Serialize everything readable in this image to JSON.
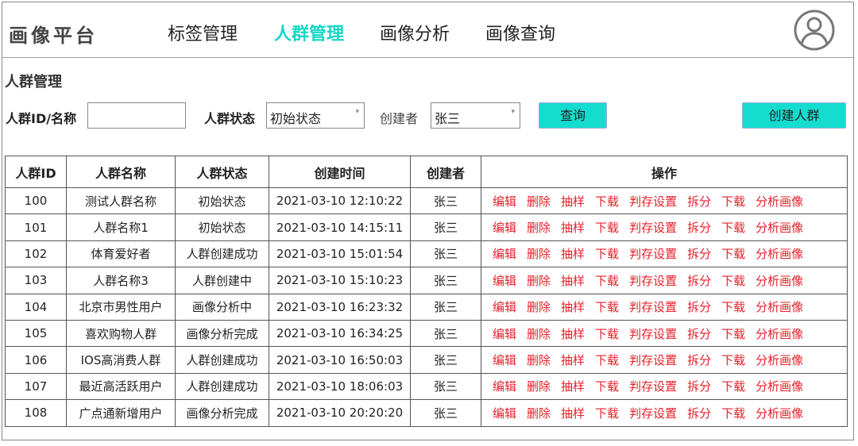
{
  "header": {
    "logo": "画像平台",
    "nav": [
      "标签管理",
      "人群管理",
      "画像分析",
      "画像查询"
    ],
    "active_index": 1
  },
  "page_title": "人群管理",
  "filters": {
    "id_name_label": "人群ID/名称",
    "id_name_value": "",
    "status_label": "人群状态",
    "status_value": "初始状态",
    "creator_label": "创建者",
    "creator_value": "张三",
    "query_button": "查询",
    "create_button": "创建人群"
  },
  "colors": {
    "accent": "#14ddd0",
    "action": "#e8202a"
  },
  "table": {
    "headers": [
      "人群ID",
      "人群名称",
      "人群状态",
      "创建时间",
      "创建者",
      "操作"
    ],
    "actions": [
      "编辑",
      "删除",
      "抽样",
      "下载",
      "判存设置",
      "拆分",
      "下载",
      "分析画像"
    ],
    "rows": [
      [
        "100",
        "测试人群名称",
        "初始状态",
        "2021-03-10 12:10:22",
        "张三"
      ],
      [
        "101",
        "人群名称1",
        "初始状态",
        "2021-03-10 14:15:11",
        "张三"
      ],
      [
        "102",
        "体育爱好者",
        "人群创建成功",
        "2021-03-10 15:01:54",
        "张三"
      ],
      [
        "103",
        "人群名称3",
        "人群创建中",
        "2021-03-10 15:10:23",
        "张三"
      ],
      [
        "104",
        "北京市男性用户",
        "画像分析中",
        "2021-03-10 16:23:32",
        "张三"
      ],
      [
        "105",
        "喜欢购物人群",
        "画像分析完成",
        "2021-03-10 16:34:25",
        "张三"
      ],
      [
        "106",
        "IOS高消费人群",
        "人群创建成功",
        "2021-03-10 16:50:03",
        "张三"
      ],
      [
        "107",
        "最近高活跃用户",
        "人群创建成功",
        "2021-03-10 18:06:03",
        "张三"
      ],
      [
        "108",
        "广点通新增用户",
        "画像分析完成",
        "2021-03-10 20:20:20",
        "张三"
      ]
    ]
  }
}
